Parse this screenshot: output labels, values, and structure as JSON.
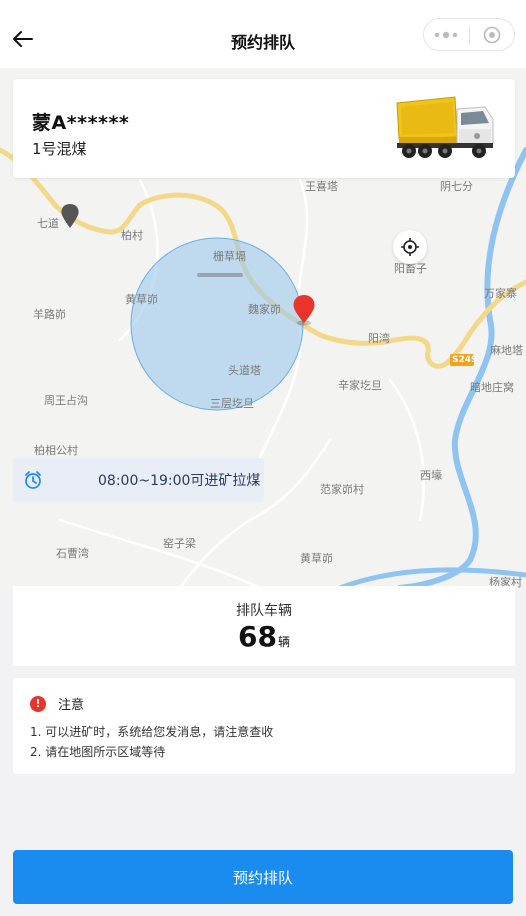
{
  "nav": {
    "title": "预约排队",
    "back_icon": "arrow-left-icon",
    "more_icon": "more-dots-icon",
    "close_icon": "target-circle-icon"
  },
  "vehicle": {
    "plate": "蒙A******",
    "cargo": "1号混煤",
    "image": "dump-truck-image"
  },
  "map": {
    "labels": [
      "王喜塔",
      "阴七分",
      "七道",
      "柏村",
      "栅草塥",
      "阳畜子",
      "黄草峁",
      "万家寨",
      "羊路峁",
      "魏家峁",
      "阳湾",
      "S249",
      "麻地塔",
      "头道塔",
      "辛家圪旦",
      "暗地庄窝",
      "周王占沟",
      "三层圪旦",
      "柏相公村",
      "西壕",
      "范家峁村",
      "窑子梁",
      "石曹湾",
      "黄草峁",
      "杨家村"
    ],
    "geofence_color": "#9cc8ef",
    "road_color": "#f3d88a",
    "river_color": "#8ec3f2",
    "marker_color": "#e8342a"
  },
  "time_banner": {
    "icon": "alarm-clock-icon",
    "text": "08:00~19:00可进矿拉煤"
  },
  "queue": {
    "label": "排队车辆",
    "count": "68",
    "unit": "辆"
  },
  "notice": {
    "icon": "warning-icon",
    "icon_glyph": "!",
    "title": "注意",
    "lines": [
      "1. 可以进矿时，系统给您发消息，请注意查收",
      "2. 请在地图所示区域等待"
    ]
  },
  "primary_button": {
    "label": "预约排队",
    "color": "#1a8cf0"
  }
}
